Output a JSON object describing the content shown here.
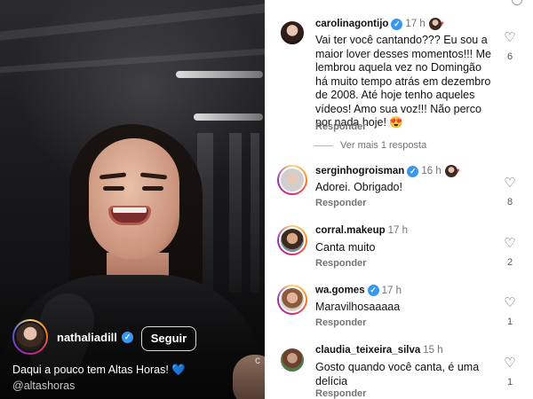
{
  "post": {
    "owner_username": "nathaliadill",
    "follow_label": "Seguir",
    "caption_text": "Daqui a pouco tem Altas Horas! 💙",
    "caption_tag": "@altashoras",
    "edge_glyph": "c"
  },
  "comments": [
    {
      "username": "carolinagontijo",
      "verified": true,
      "time": "17 h",
      "text": "Vai ter você cantando??? Eu sou a maior lover desses momentos!!! Me lembrou aquela vez no Domingão há muito tempo atrás em dezembro de 2008. Até hoje tenho aqueles vídeos! Amo sua voz!!! Não perco por nada hoje! 😍",
      "reply_label": "Responder",
      "likes": "6"
    },
    {
      "username": "serginhogroisman",
      "verified": true,
      "time": "16 h",
      "text": "Adorei.  Obrigado!",
      "reply_label": "Responder",
      "likes": "8"
    },
    {
      "username": "corral.makeup",
      "verified": false,
      "time": "17 h",
      "text": "Canta muito",
      "reply_label": "Responder",
      "likes": "2"
    },
    {
      "username": "wa.gomes",
      "verified": true,
      "time": "17 h",
      "text": "Maravilhosaaaaa",
      "reply_label": "Responder",
      "likes": "1"
    },
    {
      "username": "claudia_teixeira_silva",
      "verified": false,
      "time": "15 h",
      "text": "Gosto quando você canta, é uma delícia",
      "reply_label": "Responder",
      "likes": "1"
    }
  ],
  "view_more_replies": "Ver mais 1 resposta",
  "colors": {
    "verified_blue": "#3897f0",
    "heart_red": "#ed4956",
    "muted_gray": "#737373"
  },
  "icons": [
    "verified-badge-icon",
    "heart-outline-icon",
    "heart-filled-icon"
  ]
}
